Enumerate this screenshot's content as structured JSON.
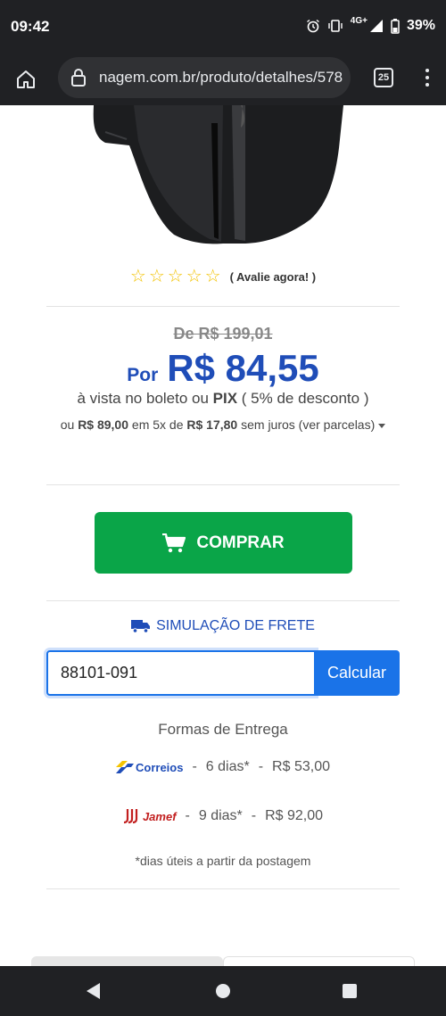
{
  "status_bar": {
    "time": "09:42",
    "network": "4G+",
    "battery": "39%",
    "icons": [
      "alarm-icon",
      "vibrate-icon",
      "signal-icon",
      "battery-icon"
    ]
  },
  "browser": {
    "url": "nagem.com.br/produto/detalhes/578",
    "tab_count": "25",
    "icons": [
      "home-icon",
      "lock-icon",
      "menu-icon"
    ]
  },
  "product": {
    "rating_link": "( Avalie agora! )",
    "stars_filled": 0,
    "stars_total": 5
  },
  "price": {
    "old": "De R$ 199,01",
    "prefix": "Por",
    "current": "R$ 84,55",
    "cash_note_pre": "à vista no boleto ou ",
    "cash_method": "PIX",
    "cash_note_post": " ( 5% de desconto )",
    "inst_pre": "ou ",
    "inst_total": "R$ 89,00",
    "inst_mid": " em 5x de ",
    "inst_each": "R$ 17,80",
    "inst_post": " sem juros (ver parcelas)"
  },
  "buy": {
    "label": "COMPRAR"
  },
  "shipping": {
    "title": "SIMULAÇÃO DE FRETE",
    "zip_value": "88101-091",
    "calc_label": "Calcular",
    "heading": "Formas de Entrega",
    "options": [
      {
        "carrier": "Correios",
        "days": "6 dias*",
        "price": "R$ 53,00"
      },
      {
        "carrier": "Jamef",
        "days": "9 dias*",
        "price": "R$ 92,00"
      }
    ],
    "separator": "-",
    "footnote": "*dias úteis a partir da postagem"
  },
  "colors": {
    "brand_blue": "#1f4db8",
    "buy_green": "#0aa548",
    "input_blue": "#1a73e8",
    "star_yellow": "#f2c200",
    "chrome_dark": "#202124"
  }
}
